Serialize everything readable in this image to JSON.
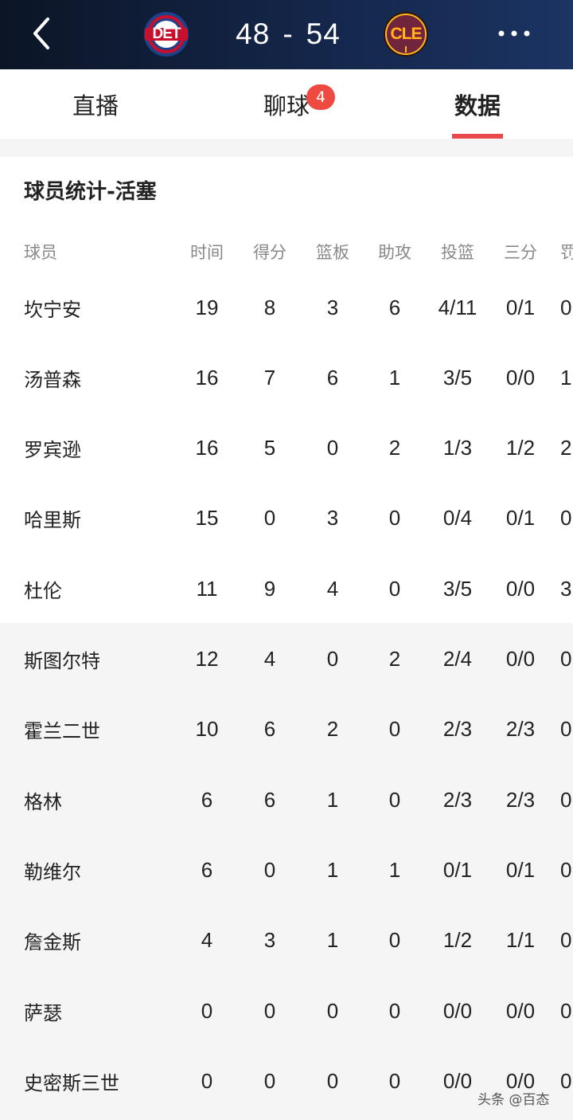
{
  "header": {
    "home_abbr": "DET",
    "away_abbr": "CLE",
    "home_score": "48",
    "separator": "-",
    "away_score": "54",
    "home_color": "#1d428a",
    "home_accent": "#c8102e",
    "away_color": "#6f263d",
    "away_accent": "#ffb81c"
  },
  "tabs": [
    {
      "label": "直播",
      "active": false
    },
    {
      "label": "聊球",
      "active": false,
      "badge": "4"
    },
    {
      "label": "数据",
      "active": true
    }
  ],
  "section_title": "球员统计-活塞",
  "columns": [
    "球员",
    "时间",
    "得分",
    "篮板",
    "助攻",
    "投篮",
    "三分",
    "罚"
  ],
  "players": [
    {
      "name": "坎宁安",
      "min": "19",
      "pts": "8",
      "reb": "3",
      "ast": "6",
      "fg": "4/11",
      "tp": "0/1",
      "ft": "0"
    },
    {
      "name": "汤普森",
      "min": "16",
      "pts": "7",
      "reb": "6",
      "ast": "1",
      "fg": "3/5",
      "tp": "0/0",
      "ft": "1"
    },
    {
      "name": "罗宾逊",
      "min": "16",
      "pts": "5",
      "reb": "0",
      "ast": "2",
      "fg": "1/3",
      "tp": "1/2",
      "ft": "2"
    },
    {
      "name": "哈里斯",
      "min": "15",
      "pts": "0",
      "reb": "3",
      "ast": "0",
      "fg": "0/4",
      "tp": "0/1",
      "ft": "0"
    },
    {
      "name": "杜伦",
      "min": "11",
      "pts": "9",
      "reb": "4",
      "ast": "0",
      "fg": "3/5",
      "tp": "0/0",
      "ft": "3"
    },
    {
      "name": "斯图尔特",
      "min": "12",
      "pts": "4",
      "reb": "0",
      "ast": "2",
      "fg": "2/4",
      "tp": "0/0",
      "ft": "0"
    },
    {
      "name": "霍兰二世",
      "min": "10",
      "pts": "6",
      "reb": "2",
      "ast": "0",
      "fg": "2/3",
      "tp": "2/3",
      "ft": "0"
    },
    {
      "name": "格林",
      "min": "6",
      "pts": "6",
      "reb": "1",
      "ast": "0",
      "fg": "2/3",
      "tp": "2/3",
      "ft": "0"
    },
    {
      "name": "勒维尔",
      "min": "6",
      "pts": "0",
      "reb": "1",
      "ast": "1",
      "fg": "0/1",
      "tp": "0/1",
      "ft": "0"
    },
    {
      "name": "詹金斯",
      "min": "4",
      "pts": "3",
      "reb": "1",
      "ast": "0",
      "fg": "1/2",
      "tp": "1/1",
      "ft": "0"
    },
    {
      "name": "萨瑟",
      "min": "0",
      "pts": "0",
      "reb": "0",
      "ast": "0",
      "fg": "0/0",
      "tp": "0/0",
      "ft": "0"
    },
    {
      "name": "史密斯三世",
      "min": "0",
      "pts": "0",
      "reb": "0",
      "ast": "0",
      "fg": "0/0",
      "tp": "0/0",
      "ft": "0"
    }
  ],
  "watermark": "头条 @百态"
}
